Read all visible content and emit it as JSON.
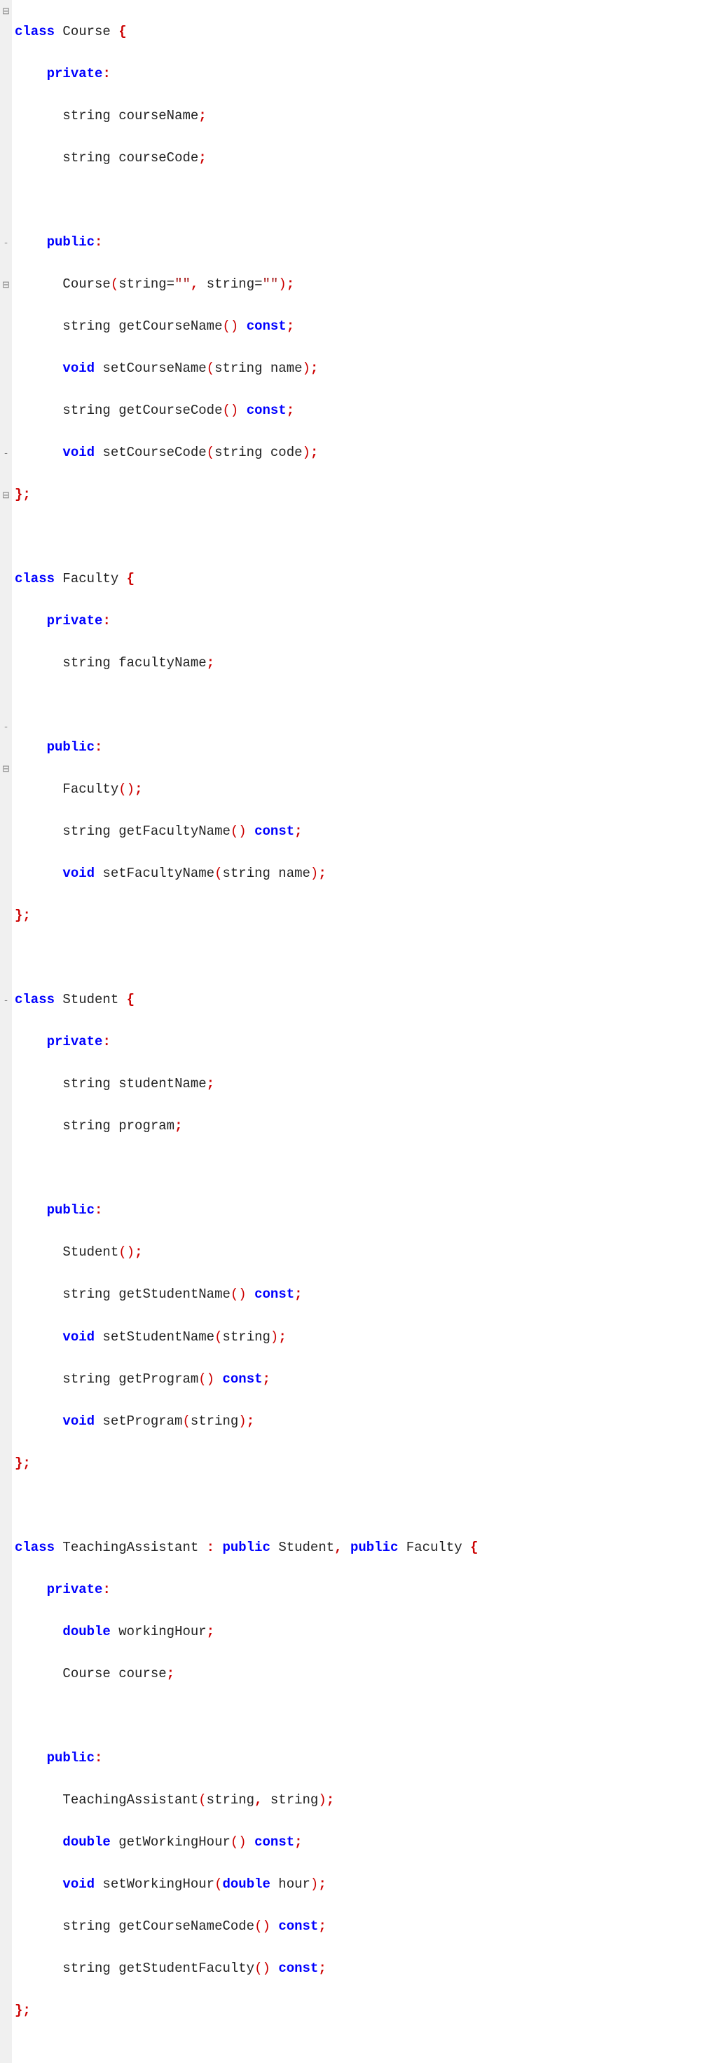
{
  "gutter": [
    "⊟",
    "",
    "",
    "",
    "",
    "",
    "",
    "",
    "",
    "",
    "",
    "-",
    "",
    "⊟",
    "",
    "",
    "",
    "",
    "",
    "",
    "",
    "-",
    "",
    "⊟",
    "",
    "",
    "",
    "",
    "",
    "",
    "",
    "",
    "",
    "",
    "-",
    "",
    "⊟",
    "",
    "",
    "",
    "",
    "",
    "",
    "",
    "",
    "",
    "",
    "-"
  ],
  "c1": {
    "kw_class": "class",
    "name": "Course",
    "open": "{",
    "private": "private",
    "colon": ":",
    "t_string": "string",
    "f1": "courseName",
    "semi": ";",
    "f2": "courseCode",
    "public": "public",
    "ctor": "Course",
    "p_open": "(",
    "arg1": "string=",
    "q1": "\"\"",
    "comma": ",",
    "arg2": " string=",
    "q2": "\"\"",
    "p_close": ")",
    "m1_ret": "string",
    "m1": "getCourseName",
    "empty": "()",
    "kw_const": "const",
    "m2_ret": "void",
    "m2": "setCourseName",
    "m2_arg": "string name",
    "m3_ret": "string",
    "m3": "getCourseCode",
    "m4_ret": "void",
    "m4": "setCourseCode",
    "m4_arg": "string code",
    "close": "};"
  },
  "c2": {
    "kw_class": "class",
    "name": "Faculty",
    "open": "{",
    "private": "private",
    "colon": ":",
    "t_string": "string",
    "f1": "facultyName",
    "semi": ";",
    "public": "public",
    "ctor": "Faculty",
    "empty": "()",
    "m1_ret": "string",
    "m1": "getFacultyName",
    "kw_const": "const",
    "m2_ret": "void",
    "m2": "setFacultyName",
    "m2_arg": "string name",
    "close": "};"
  },
  "c3": {
    "kw_class": "class",
    "name": "Student",
    "open": "{",
    "private": "private",
    "colon": ":",
    "t_string": "string",
    "f1": "studentName",
    "semi": ";",
    "f2": "program",
    "public": "public",
    "ctor": "Student",
    "empty": "()",
    "m1_ret": "string",
    "m1": "getStudentName",
    "kw_const": "const",
    "m2_ret": "void",
    "m2": "setStudentName",
    "m2_arg": "string",
    "m3_ret": "string",
    "m3": "getProgram",
    "m4_ret": "void",
    "m4": "setProgram",
    "m4_arg": "string",
    "close": "};"
  },
  "c4": {
    "kw_class": "class",
    "name": "TeachingAssistant",
    "inherit_colon": ":",
    "kw_public": "public",
    "base1": "Student",
    "comma": ",",
    "base2": "Faculty",
    "open": "{",
    "private": "private",
    "colon": ":",
    "t_double": "double",
    "f1": "workingHour",
    "semi": ";",
    "t_course": "Course",
    "f2": "course",
    "public": "public",
    "ctor": "TeachingAssistant",
    "ctor_arg": "string",
    "ctor_arg2": " string",
    "m1_ret": "double",
    "m1": "getWorkingHour",
    "kw_const": "const",
    "empty": "()",
    "m2_ret": "void",
    "m2": "setWorkingHour",
    "m2_argkw": "double",
    "m2_argn": " hour",
    "m3_ret": "string",
    "m3": "getCourseNameCode",
    "m4_ret": "string",
    "m4": "getStudentFaculty",
    "close": "};"
  }
}
